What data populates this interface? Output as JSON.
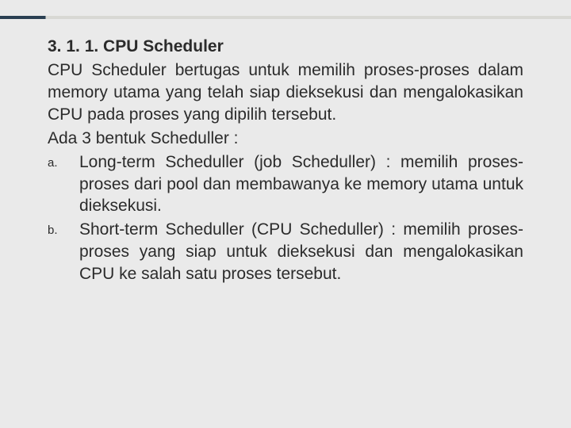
{
  "heading": "3. 1. 1. CPU Scheduler",
  "intro": "CPU Scheduler bertugas untuk memilih proses-proses dalam memory utama yang telah siap dieksekusi dan mengalokasikan CPU pada proses yang dipilih tersebut.",
  "lead": "Ada 3 bentuk Scheduller :",
  "items": [
    {
      "marker": "a.",
      "text": "Long-term Scheduller (job Scheduller) : memilih proses-proses dari pool dan membawanya ke memory utama untuk dieksekusi."
    },
    {
      "marker": "b.",
      "text": "Short-term Scheduller (CPU Scheduller) : memilih proses-proses yang siap untuk dieksekusi dan mengalokasikan CPU ke salah satu proses tersebut."
    }
  ]
}
